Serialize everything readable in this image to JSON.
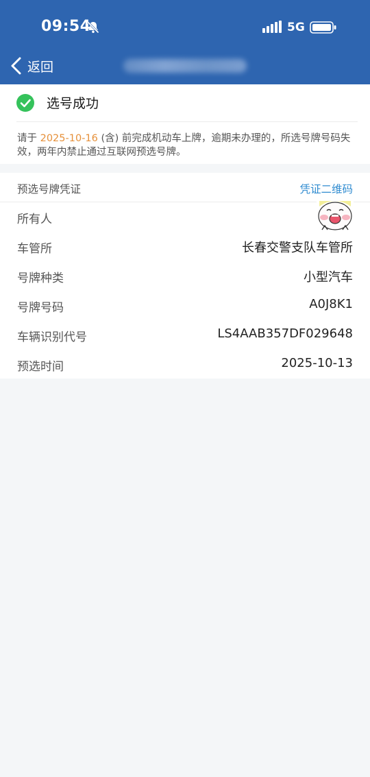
{
  "status_bar": {
    "time": "09:54",
    "mute_icon": "bell-slash-icon",
    "signal_icon": "cellular-signal-icon",
    "network": "5G",
    "battery_icon": "battery-icon"
  },
  "nav": {
    "back_label": "返回",
    "back_icon": "chevron-left-icon",
    "header_color": "#2e65b0"
  },
  "success": {
    "icon": "check-circle-icon",
    "title": "选号成功",
    "notice_prefix": "请于 ",
    "notice_date": "2025-10-16",
    "notice_suffix": " (含) 前完成机动车上牌，逾期未办理的，所选号牌号码失效，两年内禁止通过互联网预选号牌。",
    "accent_color": "#e6903a",
    "check_color": "#35c25b"
  },
  "certificate": {
    "title": "预选号牌凭证",
    "qr_link": "凭证二维码",
    "link_color": "#2f8bd0",
    "rows": [
      {
        "label": "所有人",
        "value": ""
      },
      {
        "label": "车管所",
        "value": "长春交警支队车管所"
      },
      {
        "label": "号牌种类",
        "value": "小型汽车"
      },
      {
        "label": "号牌号码",
        "value": "A0J8K1"
      },
      {
        "label": "车辆识别代号",
        "value": "LS4AAB357DF029648"
      },
      {
        "label": "预选时间",
        "value": "2025-10-13"
      }
    ]
  }
}
